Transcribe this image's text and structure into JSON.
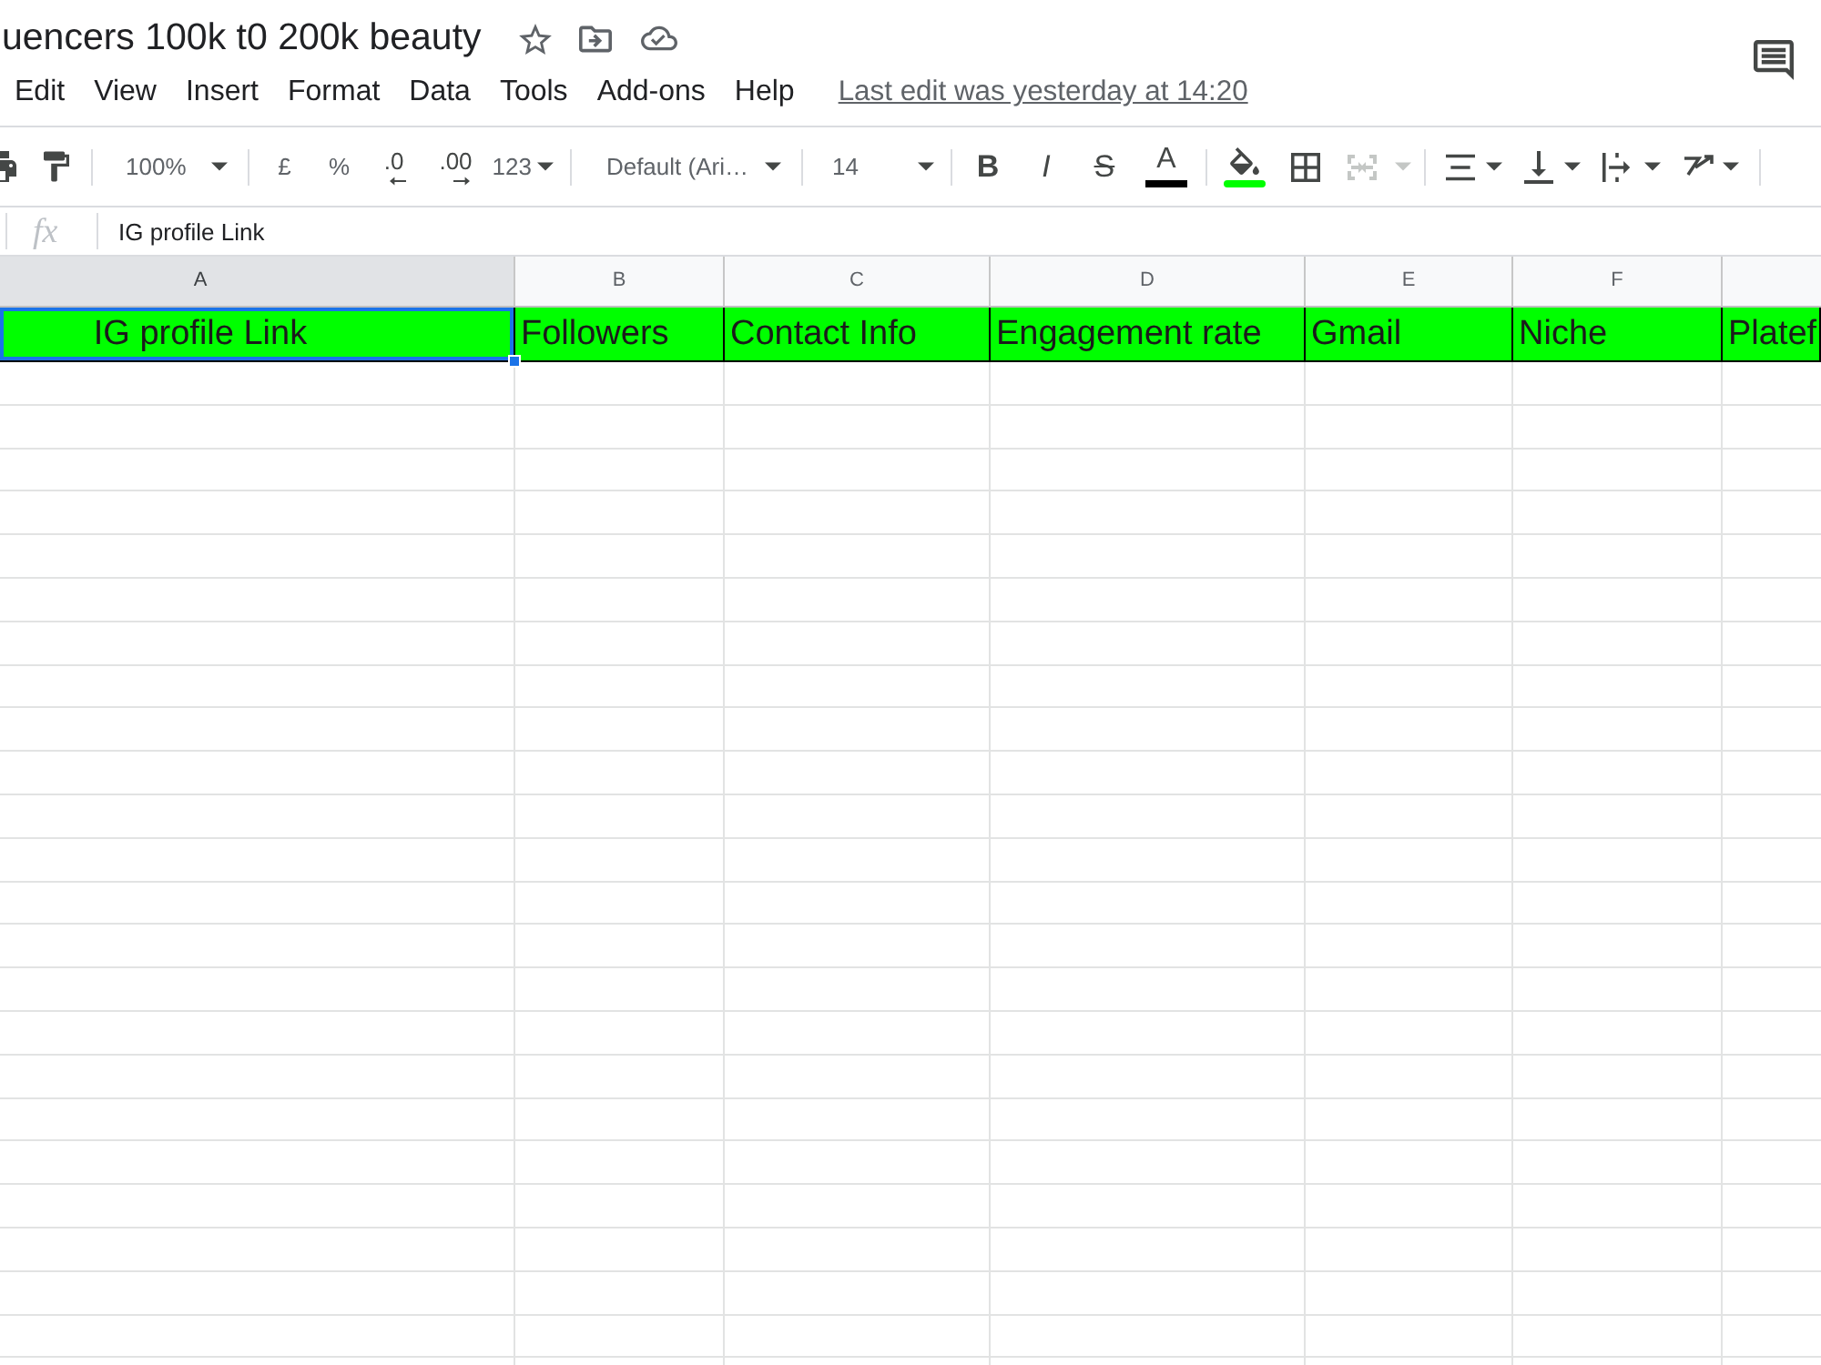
{
  "title": "uencers 100k t0 200k beauty",
  "menu": [
    "Edit",
    "View",
    "Insert",
    "Format",
    "Data",
    "Tools",
    "Add-ons",
    "Help"
  ],
  "last_edit": "Last edit was yesterday at 14:20",
  "toolbar": {
    "zoom": "100%",
    "currency": "£",
    "percent": "%",
    "decimal_less": ".0",
    "decimal_more": ".00",
    "number_format": "123",
    "font": "Default (Ari…",
    "font_size": "14",
    "format_buttons": [
      {
        "kind": "bold",
        "label": "B"
      },
      {
        "kind": "italic",
        "label": "I"
      },
      {
        "kind": "strikethrough",
        "label": "S"
      },
      {
        "kind": "text_color",
        "label": "A",
        "color": "#000000"
      },
      {
        "kind": "fill_color",
        "color": "#00ff00"
      }
    ],
    "merge_disabled": true
  },
  "formula_bar": {
    "label": "fx",
    "value": "IG profile Link"
  },
  "columns": [
    {
      "letter": "A",
      "selected": true
    },
    {
      "letter": "B",
      "selected": false
    },
    {
      "letter": "C",
      "selected": false
    },
    {
      "letter": "D",
      "selected": false
    },
    {
      "letter": "E",
      "selected": false
    },
    {
      "letter": "F",
      "selected": false
    }
  ],
  "rows": [
    {
      "color": "#00ff00",
      "cells": [
        {
          "text": "IG profile Link",
          "selected": true,
          "centered": true
        },
        {
          "text": "Followers",
          "selected": false,
          "centered": false
        },
        {
          "text": "Contact Info",
          "selected": false,
          "centered": false
        },
        {
          "text": "Engagement rate",
          "selected": false,
          "centered": false
        },
        {
          "text": "Gmail",
          "selected": false,
          "centered": false
        },
        {
          "text": "Niche",
          "selected": false,
          "centered": false
        },
        {
          "text": "Platef",
          "selected": false,
          "centered": false
        }
      ]
    }
  ]
}
